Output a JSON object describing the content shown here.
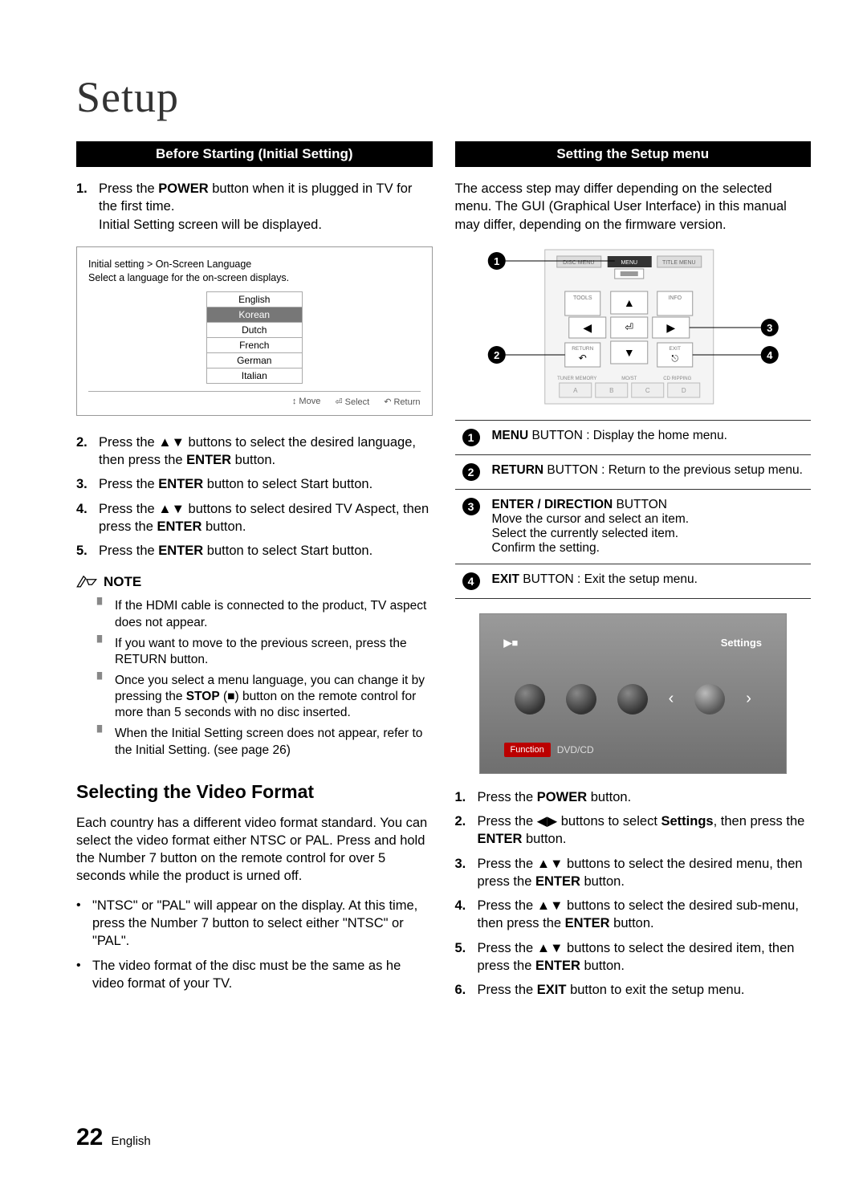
{
  "title": "Setup",
  "left": {
    "bar": "Before Starting (Initial Setting)",
    "steps_a": [
      "Press the <b>POWER</b> button when it is plugged in TV for the first time.<br>Initial Setting screen will be displayed."
    ],
    "osd": {
      "breadcrumb": "Initial setting > On-Screen Language",
      "prompt": "Select a language for the on-screen displays.",
      "items": [
        "English",
        "Korean",
        "Dutch",
        "French",
        "German",
        "Italian"
      ],
      "selected": 1,
      "footer": [
        "↕ Move",
        "⏎ Select",
        "↶ Return"
      ]
    },
    "steps_b": [
      "Press the ▲▼ buttons to select the desired language, then press the <b>ENTER</b> button.",
      "Press the <b>ENTER</b> button to select Start button.",
      "Press the ▲▼ buttons to select desired TV Aspect, then press the <b>ENTER</b> button.",
      "Press the <b>ENTER</b> button to select Start button."
    ],
    "note_label": "NOTE",
    "notes": [
      "If the HDMI cable is connected to the product, TV aspect does not appear.",
      "If you want to move to the previous screen, press the RETURN button.",
      "Once you select a menu language, you can change it by pressing the <b>STOP</b> (■) button on the remote control for more than 5 seconds with no disc inserted.",
      "When the Initial Setting screen does not appear, refer to the Initial Setting. (see page 26)"
    ],
    "subhead": "Selecting the Video Format",
    "para": "Each country has a different video format standard. You can select the video format either NTSC or PAL. Press and hold the Number 7 button on the remote control for over 5 seconds while the product is urned off.",
    "bullets": [
      "\"NTSC\" or \"PAL\" will appear on the display. At this time, press the Number 7 button to select either \"NTSC\" or \"PAL\".",
      "The video format of the disc must be the same as he video format of your TV."
    ]
  },
  "right": {
    "bar": "Setting the Setup menu",
    "intro": "The access step may differ depending on the selected menu. The GUI (Graphical User Interface) in this manual may differ, depending on the firmware version.",
    "remote_buttons": [
      "DISC MENU",
      "MENU",
      "TITLE MENU",
      "TOOLS",
      "INFO",
      "RETURN",
      "EXIT",
      "TUNER MEMORY",
      "MO/ST",
      "CD RIPPING"
    ],
    "callouts": [
      "<b>MENU</b> BUTTON : Display the home menu.",
      "<b>RETURN</b> BUTTON : Return to the previous setup menu.",
      "<b>ENTER / DIRECTION</b> BUTTON<br>Move the cursor and select an item.<br>Select the currently selected item.<br>Confirm the setting.",
      "<b>EXIT</b> BUTTON : Exit the setup menu."
    ],
    "tv": {
      "label_settings": "Settings",
      "btn": "Function",
      "src": "DVD/CD"
    },
    "steps": [
      "Press the <b>POWER</b> button.",
      "Press the ◀▶ buttons to select <b>Settings</b>, then press the <b>ENTER</b> button.",
      "Press the ▲▼ buttons to select the desired menu, then press the <b>ENTER</b> button.",
      "Press the ▲▼ buttons to select the desired sub-menu, then press the <b>ENTER</b> button.",
      "Press the ▲▼ buttons to select the desired item, then press the <b>ENTER</b> button.",
      "Press the <b>EXIT</b> button to exit the setup menu."
    ]
  },
  "footer": {
    "page": "22",
    "lang": "English"
  }
}
